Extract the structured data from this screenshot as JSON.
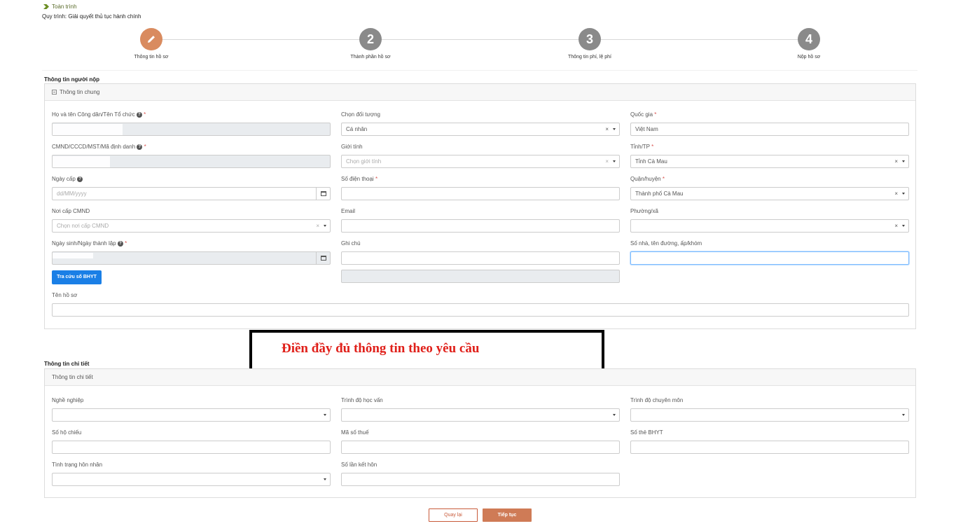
{
  "breadcrumb": {
    "label": "Toàn trình"
  },
  "process": {
    "label": "Quy trình: Giải quyết thủ tục hành chính"
  },
  "steps": [
    {
      "number": "",
      "label": "Thông tin hồ sơ"
    },
    {
      "number": "2",
      "label": "Thành phần hồ sơ"
    },
    {
      "number": "3",
      "label": "Thông tin phí, lệ phí"
    },
    {
      "number": "4",
      "label": "Nộp hồ sơ"
    }
  ],
  "applicant": {
    "section_title": "Thông tin người nộp",
    "panel_title": "Thông tin chung",
    "full_name_label": "Họ và tên Công dân/Tên Tổ chức",
    "subject_label": "Chọn đối tượng",
    "subject_value": "Cá nhân",
    "country_label": "Quốc gia",
    "country_value": "Việt Nam",
    "id_label": "CMND/CCCD/MST/Mã định danh",
    "gender_label": "Giới tính",
    "gender_placeholder": "Chọn giới tính",
    "province_label": "Tỉnh/TP",
    "province_value": "Tỉnh Cà Mau",
    "issue_date_label": "Ngày cấp",
    "issue_date_placeholder": "dd/MM/yyyy",
    "phone_label": "Số điện thoại",
    "district_label": "Quận/huyện",
    "district_value": "Thành phố Cà Mau",
    "issue_place_label": "Nơi cấp CMND",
    "issue_place_placeholder": "Chọn nơi cấp CMND",
    "email_label": "Email",
    "ward_label": "Phường/xã",
    "birth_label": "Ngày sinh/Ngày thành lập",
    "note_label": "Ghi chú",
    "address_label": "Số nhà, tên đường, ấp/khóm",
    "bhyt_button": "Tra cứu số BHYT",
    "dossier_name_label": "Tên hồ sơ"
  },
  "callout": {
    "text": "Điền đầy đủ thông tin theo yêu cầu"
  },
  "details": {
    "section_title": "Thông tin chi tiết",
    "panel_title": "Thông tin chi tiết",
    "occupation_label": "Nghề nghiệp",
    "education_label": "Trình độ học vấn",
    "expertise_label": "Trình độ chuyên môn",
    "passport_label": "Số hộ chiếu",
    "tax_label": "Mã số thuế",
    "bhyt_label": "Số thẻ BHYT",
    "marital_label": "Tình trạng hôn nhân",
    "marriage_count_label": "Số lần kết hôn"
  },
  "actions": {
    "back": "Quay lại",
    "next": "Tiếp tục"
  },
  "colors": {
    "accent": "#d98b5f",
    "primary": "#1a7fe6",
    "required": "#d9534f",
    "callout": "#e0201a"
  }
}
